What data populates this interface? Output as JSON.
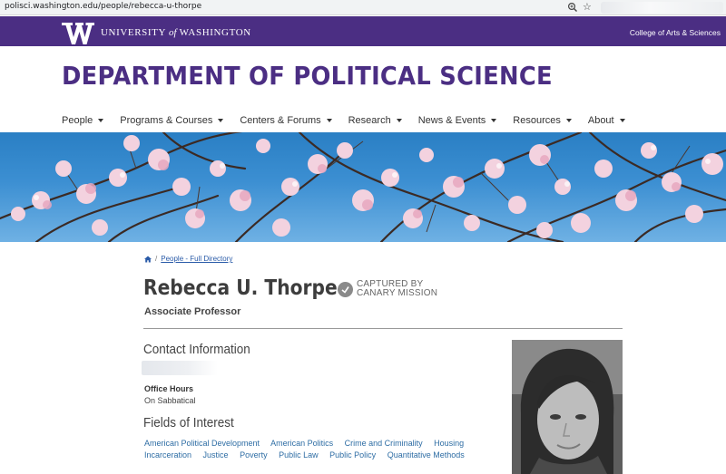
{
  "browser": {
    "url": "polisci.washington.edu/people/rebecca-u-thorpe"
  },
  "uw_header": {
    "university_pre": "UNIVERSITY",
    "university_of": "of",
    "university_post": "WASHINGTON",
    "college_link": "College of Arts & Sciences"
  },
  "department_title": "DEPARTMENT OF POLITICAL SCIENCE",
  "nav": {
    "items": [
      "People",
      "Programs & Courses",
      "Centers & Forums",
      "Research",
      "News & Events",
      "Resources",
      "About"
    ]
  },
  "breadcrumb": {
    "separator": "/",
    "link": "People - Full Directory"
  },
  "profile": {
    "name": "Rebecca U. Thorpe",
    "title": "Associate Professor",
    "stamp_line1": "CAPTURED BY",
    "stamp_line2": "CANARY MISSION"
  },
  "contact": {
    "heading": "Contact Information",
    "office_hours_label": "Office Hours",
    "office_hours_value": "On Sabbatical"
  },
  "fields_of_interest": {
    "heading": "Fields of Interest",
    "items": [
      "American Political Development",
      "American Politics",
      "Crime and Criminality",
      "Housing",
      "Incarceration",
      "Justice",
      "Poverty",
      "Public Law",
      "Public Policy",
      "Quantitative Methods"
    ]
  },
  "colors": {
    "uw_purple": "#4b2e83",
    "link_blue": "#2e6da4"
  },
  "icons": [
    "zoom-icon",
    "star-icon",
    "w-logo-icon",
    "home-icon",
    "stamp-seal-icon",
    "caret-down-icon"
  ]
}
